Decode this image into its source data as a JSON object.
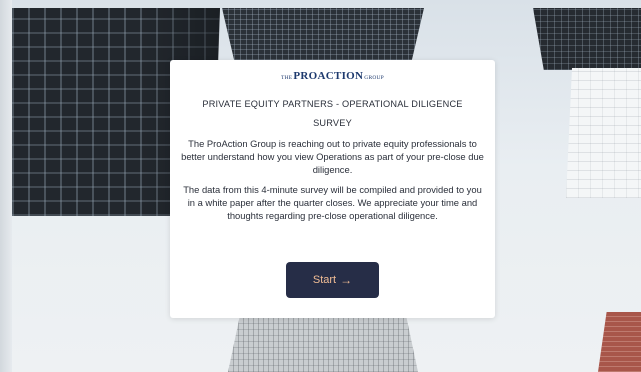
{
  "logo": {
    "prefix": "THE",
    "name": "PROACTION",
    "suffix": "GROUP"
  },
  "survey": {
    "title": "PRIVATE EQUITY PARTNERS - OPERATIONAL DILIGENCE SURVEY",
    "intro": "The ProAction Group is reaching out to private equity professionals to better understand how you view Operations as part of your pre-close due diligence.",
    "details": "The data from this 4-minute survey will be compiled and provided to you in a white paper after the quarter closes.  We appreciate your time and thoughts regarding pre-close operational diligence.",
    "start_label": "Start",
    "start_icon": "arrow-right-icon",
    "start_glyph": "→"
  },
  "colors": {
    "button_bg": "#262d47",
    "button_text": "#f1bd95",
    "logo": "#1e3a6e"
  }
}
